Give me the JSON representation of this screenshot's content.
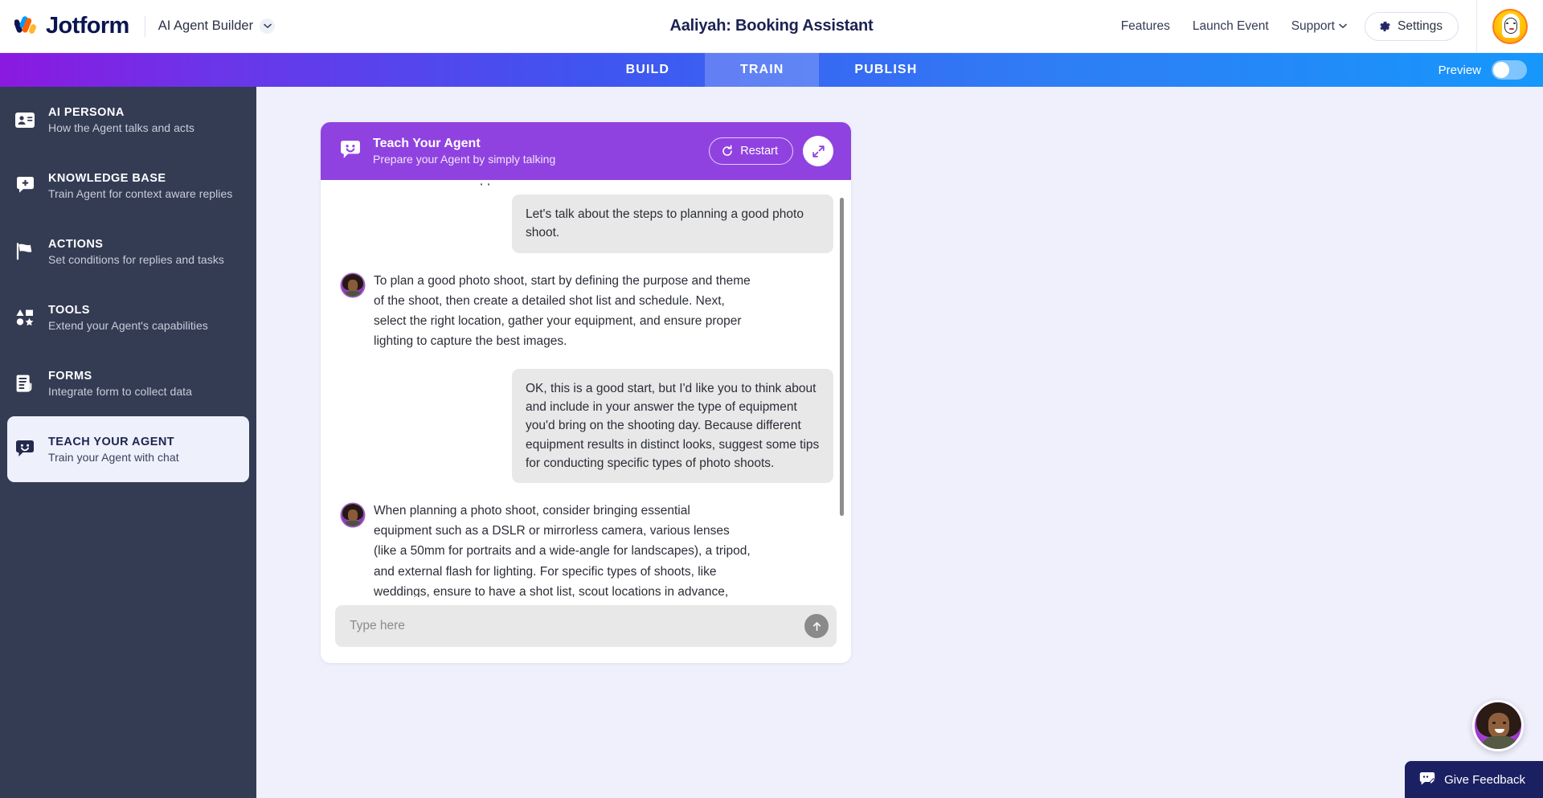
{
  "header": {
    "logo_text": "Jotform",
    "logo_icon": "jotform-logo-icon",
    "product_name": "AI Agent Builder",
    "product_chevron_icon": "chevron-down-icon",
    "page_title": "Aaliyah: Booking Assistant",
    "links": [
      {
        "label": "Features",
        "name": "features"
      },
      {
        "label": "Launch Event",
        "name": "launch-event"
      },
      {
        "label": "Support",
        "name": "support",
        "chevron": "chevron-down-icon"
      }
    ],
    "settings_label": "Settings",
    "settings_icon": "gear-icon",
    "avatar_name": "user-avatar"
  },
  "tabbar": {
    "tabs": [
      {
        "label": "BUILD",
        "active": false
      },
      {
        "label": "TRAIN",
        "active": true
      },
      {
        "label": "PUBLISH",
        "active": false
      }
    ],
    "preview_label": "Preview",
    "preview_on": false
  },
  "sidebar": {
    "items": [
      {
        "title": "AI PERSONA",
        "subtitle": "How the Agent talks and acts",
        "icon": "id-card-icon",
        "active": false
      },
      {
        "title": "KNOWLEDGE BASE",
        "subtitle": "Train Agent for context aware replies",
        "icon": "chat-plus-icon",
        "active": false
      },
      {
        "title": "ACTIONS",
        "subtitle": "Set conditions for replies and tasks",
        "icon": "flag-icon",
        "active": false
      },
      {
        "title": "TOOLS",
        "subtitle": "Extend your Agent's capabilities",
        "icon": "shapes-icon",
        "active": false
      },
      {
        "title": "FORMS",
        "subtitle": "Integrate form to collect data",
        "icon": "form-clip-icon",
        "active": false
      },
      {
        "title": "TEACH YOUR AGENT",
        "subtitle": "Train your Agent with chat",
        "icon": "chat-smile-icon",
        "active": true
      }
    ]
  },
  "chat": {
    "header": {
      "title": "Teach Your Agent",
      "subtitle": "Prepare your Agent by simply talking",
      "icon": "chat-smile-icon",
      "restart_label": "Restart",
      "restart_icon": "restart-icon",
      "expand_icon": "expand-diagonal-icon",
      "accent_color": "#9042E0"
    },
    "clipped_top_line": "” ” , ,",
    "messages": [
      {
        "role": "user",
        "text": "Let's talk about the steps to planning a good photo shoot."
      },
      {
        "role": "agent",
        "text": "To plan a good photo shoot, start by defining the purpose and theme of the shoot, then create a detailed shot list and schedule. Next, select the right location, gather your equipment, and ensure proper lighting to capture the best images."
      },
      {
        "role": "user",
        "text": "OK, this is a good start, but I'd like you to think about and include in your answer the type of equipment you'd bring on the shooting day. Because different equipment results in distinct looks, suggest some tips for conducting specific types of photo shoots."
      },
      {
        "role": "agent",
        "text": "When planning a photo shoot, consider bringing essential equipment such as a DSLR or mirrorless camera, various lenses (like a 50mm for portraits and a wide-angle for landscapes), a tripod, and external flash for lighting. For specific types of shoots, like weddings, ensure to have a shot list, scout locations in advance, and use appropriate lighting techniques to create the desired atmosphere."
      }
    ],
    "input": {
      "value": "",
      "placeholder": "Type here",
      "send_icon": "arrow-up-icon"
    }
  },
  "widgets": {
    "agent_bubble_name": "agent-chat-bubble",
    "feedback_label": "Give Feedback",
    "feedback_icon": "feedback-chat-icon"
  }
}
